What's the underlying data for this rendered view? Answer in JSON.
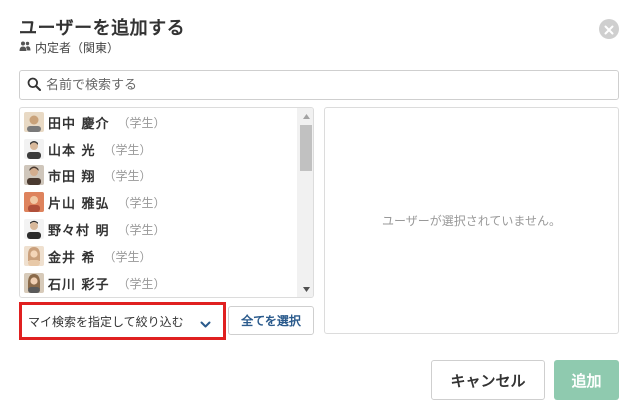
{
  "dialog": {
    "title": "ユーザーを追加する",
    "group_name": "内定者（関東）"
  },
  "search": {
    "placeholder": "名前で検索する",
    "value": ""
  },
  "users": [
    {
      "name": "田中 慶介",
      "type": "（学生）",
      "avatar_color": "#c9a27a"
    },
    {
      "name": "山本 光",
      "type": "（学生）",
      "avatar_color": "#3b3b3b"
    },
    {
      "name": "市田 翔",
      "type": "（学生）",
      "avatar_color": "#4a3a30"
    },
    {
      "name": "片山 雅弘",
      "type": "（学生）",
      "avatar_color": "#d9704a"
    },
    {
      "name": "野々村 明",
      "type": "（学生）",
      "avatar_color": "#2c2c2c"
    },
    {
      "name": "金井 希",
      "type": "（学生）",
      "avatar_color": "#caa07c"
    },
    {
      "name": "石川 彩子",
      "type": "（学生）",
      "avatar_color": "#8a6a4a"
    }
  ],
  "selected_panel": {
    "empty_message": "ユーザーが選択されていません。"
  },
  "filter": {
    "label": "マイ検索を指定して絞り込む"
  },
  "buttons": {
    "select_all": "全てを選択",
    "cancel": "キャンセル",
    "add": "追加"
  },
  "colors": {
    "accent_add": "#8fcaaf",
    "select_all_text": "#2a5a8c",
    "highlight": "#e02020",
    "filter_chevron": "#2a5a8c"
  },
  "icons": {
    "group": "people-icon",
    "search": "search-icon",
    "close": "close-icon",
    "chevron": "chevron-down-icon"
  }
}
